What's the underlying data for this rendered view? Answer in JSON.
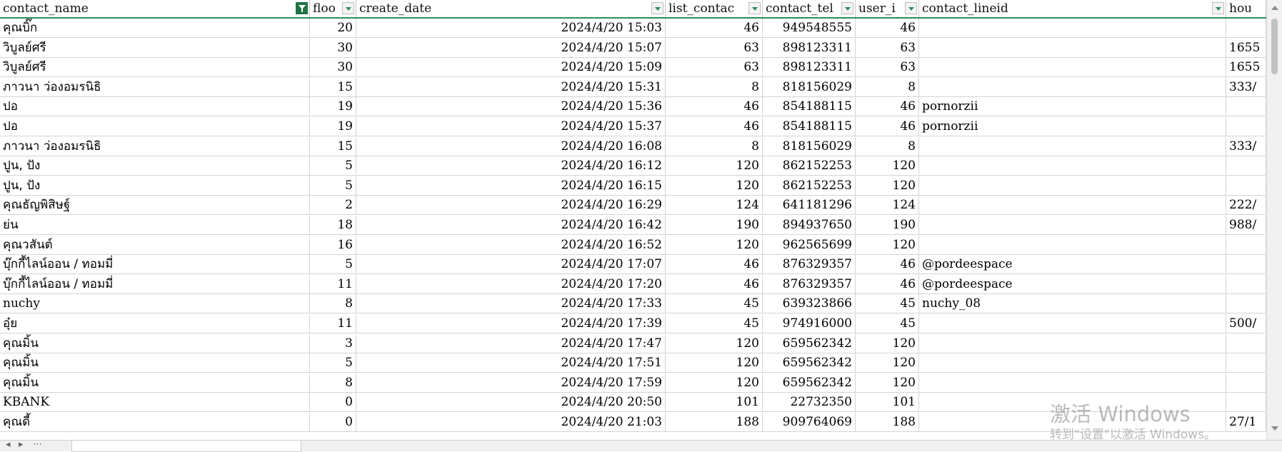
{
  "columns": [
    {
      "key": "contact_name",
      "label": "contact_name",
      "filter_active": true
    },
    {
      "key": "floor",
      "label": "floo",
      "filter_active": false
    },
    {
      "key": "create_date",
      "label": "create_date",
      "filter_active": false
    },
    {
      "key": "list_contact",
      "label": "list_contac",
      "filter_active": false
    },
    {
      "key": "contact_tel",
      "label": "contact_tel",
      "filter_active": false
    },
    {
      "key": "user_id",
      "label": "user_i",
      "filter_active": false
    },
    {
      "key": "contact_lineid",
      "label": "contact_lineid",
      "filter_active": false
    },
    {
      "key": "house",
      "label": "hous",
      "filter_active": false
    }
  ],
  "rows": [
    {
      "name": "คุณบิ๊ก",
      "floor": "20",
      "date": "2024/4/20 15:03",
      "list": "46",
      "tel": "949548555",
      "uid": "46",
      "lineid": "",
      "house": ""
    },
    {
      "name": "วิบูลย์ศรี",
      "floor": "30",
      "date": "2024/4/20 15:07",
      "list": "63",
      "tel": "898123311",
      "uid": "63",
      "lineid": "",
      "house": "1655"
    },
    {
      "name": "วิบูลย์ศรี",
      "floor": "30",
      "date": "2024/4/20 15:09",
      "list": "63",
      "tel": "898123311",
      "uid": "63",
      "lineid": "",
      "house": "1655"
    },
    {
      "name": "ภาวนา ว่องอมรนิธิ",
      "floor": "15",
      "date": "2024/4/20 15:31",
      "list": "8",
      "tel": "818156029",
      "uid": "8",
      "lineid": "",
      "house": "333/"
    },
    {
      "name": "ปอ",
      "floor": "19",
      "date": "2024/4/20 15:36",
      "list": "46",
      "tel": "854188115",
      "uid": "46",
      "lineid": "pornorzii",
      "house": ""
    },
    {
      "name": "ปอ",
      "floor": "19",
      "date": "2024/4/20 15:37",
      "list": "46",
      "tel": "854188115",
      "uid": "46",
      "lineid": "pornorzii",
      "house": ""
    },
    {
      "name": "ภาวนา ว่องอมรนิธิ",
      "floor": "15",
      "date": "2024/4/20 16:08",
      "list": "8",
      "tel": "818156029",
      "uid": "8",
      "lineid": "",
      "house": "333/"
    },
    {
      "name": "ปูน, ปัง",
      "floor": "5",
      "date": "2024/4/20 16:12",
      "list": "120",
      "tel": "862152253",
      "uid": "120",
      "lineid": "",
      "house": ""
    },
    {
      "name": "ปูน, ปัง",
      "floor": "5",
      "date": "2024/4/20 16:15",
      "list": "120",
      "tel": "862152253",
      "uid": "120",
      "lineid": "",
      "house": ""
    },
    {
      "name": "คุณธัญพิสิษฐ์",
      "floor": "2",
      "date": "2024/4/20 16:29",
      "list": "124",
      "tel": "641181296",
      "uid": "124",
      "lineid": "",
      "house": "222/"
    },
    {
      "name": "ย่น",
      "floor": "18",
      "date": "2024/4/20 16:42",
      "list": "190",
      "tel": "894937650",
      "uid": "190",
      "lineid": "",
      "house": "988/"
    },
    {
      "name": "คุณวสันต์",
      "floor": "16",
      "date": "2024/4/20 16:52",
      "list": "120",
      "tel": "962565699",
      "uid": "120",
      "lineid": "",
      "house": ""
    },
    {
      "name": "บุ๊กกี้ไลน์ออน / ทอมมี่",
      "floor": "5",
      "date": "2024/4/20 17:07",
      "list": "46",
      "tel": "876329357",
      "uid": "46",
      "lineid": "@pordeespace",
      "house": ""
    },
    {
      "name": "บุ๊กกี้ไลน์ออน / ทอมมี่",
      "floor": "11",
      "date": "2024/4/20 17:20",
      "list": "46",
      "tel": "876329357",
      "uid": "46",
      "lineid": "@pordeespace",
      "house": ""
    },
    {
      "name": "nuchy",
      "floor": "8",
      "date": "2024/4/20 17:33",
      "list": "45",
      "tel": "639323866",
      "uid": "45",
      "lineid": "nuchy_08",
      "house": ""
    },
    {
      "name": "อุ๋ย",
      "floor": "11",
      "date": "2024/4/20 17:39",
      "list": "45",
      "tel": "974916000",
      "uid": "45",
      "lineid": "",
      "house": "500/"
    },
    {
      "name": "คุณมิ้น",
      "floor": "3",
      "date": "2024/4/20 17:47",
      "list": "120",
      "tel": "659562342",
      "uid": "120",
      "lineid": "",
      "house": ""
    },
    {
      "name": "คุณมิ้น",
      "floor": "5",
      "date": "2024/4/20 17:51",
      "list": "120",
      "tel": "659562342",
      "uid": "120",
      "lineid": "",
      "house": ""
    },
    {
      "name": "คุณมิ้น",
      "floor": "8",
      "date": "2024/4/20 17:59",
      "list": "120",
      "tel": "659562342",
      "uid": "120",
      "lineid": "",
      "house": ""
    },
    {
      "name": "KBANK",
      "floor": "0",
      "date": "2024/4/20 20:50",
      "list": "101",
      "tel": "22732350",
      "uid": "101",
      "lineid": "",
      "house": ""
    },
    {
      "name": "คุณดี้",
      "floor": "0",
      "date": "2024/4/20 21:03",
      "list": "188",
      "tel": "909764069",
      "uid": "188",
      "lineid": "",
      "house": "27/1"
    }
  ],
  "watermark": {
    "line1": "激活 Windows",
    "line2": "转到\"设置\"以激活 Windows。"
  },
  "colors": {
    "accent": "#217346",
    "header_underline": "#2e8b57",
    "grid": "#d4d4d4"
  }
}
